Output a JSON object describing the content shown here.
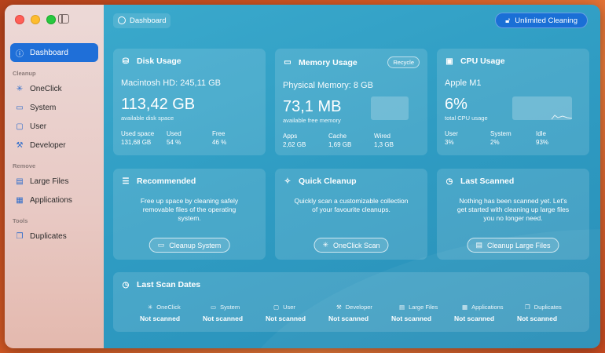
{
  "sidebar": {
    "items": [
      {
        "label": "Dashboard",
        "icon": "info-icon",
        "active": true
      },
      {
        "label": "OneClick",
        "icon": "sparkle-icon"
      },
      {
        "label": "System",
        "icon": "laptop-icon"
      },
      {
        "label": "User",
        "icon": "folder-icon"
      },
      {
        "label": "Developer",
        "icon": "hammer-icon"
      },
      {
        "label": "Large Files",
        "icon": "document-icon"
      },
      {
        "label": "Applications",
        "icon": "grid-icon"
      },
      {
        "label": "Duplicates",
        "icon": "duplicate-icon"
      }
    ],
    "sections": {
      "cleanup": "Cleanup",
      "remove": "Remove",
      "tools": "Tools"
    }
  },
  "header": {
    "title": "Dashboard",
    "unlimited_label": "Unlimited Cleaning"
  },
  "disk": {
    "title": "Disk Usage",
    "volume": "Macintosh HD: 245,11 GB",
    "available": "113,42 GB",
    "available_label": "available disk space",
    "stats": [
      {
        "label": "Used space",
        "value": "131,68 GB"
      },
      {
        "label": "Used",
        "value": "54 %"
      },
      {
        "label": "Free",
        "value": "46 %"
      }
    ]
  },
  "memory": {
    "title": "Memory Usage",
    "recycle_label": "Recycle",
    "physical": "Physical Memory: 8 GB",
    "available": "73,1 MB",
    "available_label": "available free memory",
    "stats": [
      {
        "label": "Apps",
        "value": "2,62 GB"
      },
      {
        "label": "Cache",
        "value": "1,69 GB"
      },
      {
        "label": "Wired",
        "value": "1,3 GB"
      }
    ]
  },
  "cpu": {
    "title": "CPU Usage",
    "model": "Apple M1",
    "usage": "6%",
    "usage_label": "total CPU usage",
    "stats": [
      {
        "label": "User",
        "value": "3%"
      },
      {
        "label": "System",
        "value": "2%"
      },
      {
        "label": "Idle",
        "value": "93%"
      }
    ]
  },
  "recommended": {
    "title": "Recommended",
    "text": "Free up space by cleaning safely removable files of the operating system.",
    "button": "Cleanup System"
  },
  "quick": {
    "title": "Quick Cleanup",
    "text": "Quickly scan a customizable collection of your favourite cleanups.",
    "button": "OneClick Scan"
  },
  "last_scanned": {
    "title": "Last Scanned",
    "text": "Nothing has been scanned yet. Let's get started with cleaning up large files you no longer need.",
    "button": "Cleanup Large Files"
  },
  "scan_dates": {
    "title": "Last Scan Dates",
    "items": [
      {
        "label": "OneClick",
        "value": "Not scanned"
      },
      {
        "label": "System",
        "value": "Not scanned"
      },
      {
        "label": "User",
        "value": "Not scanned"
      },
      {
        "label": "Developer",
        "value": "Not scanned"
      },
      {
        "label": "Large Files",
        "value": "Not scanned"
      },
      {
        "label": "Applications",
        "value": "Not scanned"
      },
      {
        "label": "Duplicates",
        "value": "Not scanned"
      }
    ]
  },
  "colors": {
    "accent": "#1f6fd8",
    "main_bg": "#2e9bc2"
  }
}
